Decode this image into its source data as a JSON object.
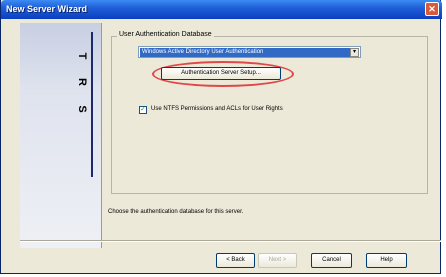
{
  "window": {
    "title": "New Server Wizard",
    "close_glyph": "✕"
  },
  "sidebar": {
    "letters": [
      "S",
      "R",
      "T"
    ]
  },
  "group": {
    "label": "User Authentication Database"
  },
  "dropdown": {
    "value": "Windows Active Directory User Authentication",
    "arrow_glyph": "▾"
  },
  "auth_button": {
    "label": "Authentication Server Setup..."
  },
  "checkbox": {
    "label": "Use NTFS Permissions and ACLs for User Rights",
    "checked": true,
    "mark": "✓"
  },
  "hint": {
    "text": "Choose the authentication database for this server."
  },
  "footer": {
    "back": "< Back",
    "next": "Next >",
    "cancel": "Cancel",
    "help": "Help"
  },
  "colors": {
    "title_bar": "#0a3fc0",
    "highlight": "#e04848",
    "selection": "#316ac5"
  }
}
